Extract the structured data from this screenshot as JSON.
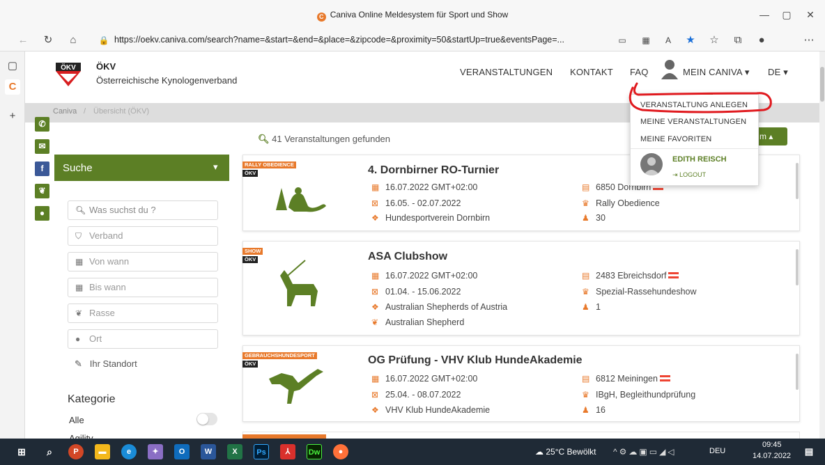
{
  "browser": {
    "window_title": "Caniva Online Meldesystem für Sport und Show",
    "url": "https://oekv.caniva.com/search?name=&start=&end=&place=&zipcode=&proximity=50&startUp=true&eventsPage=..."
  },
  "site": {
    "org_short": "ÖKV",
    "org_name": "Österreichische Kynologenverband",
    "logo_text": "ÖKV",
    "nav": {
      "events": "VERANSTALTUNGEN",
      "contact": "KONTAKT",
      "faq": "FAQ",
      "my_caniva": "MEIN CANIVA",
      "lang": "DE"
    },
    "breadcrumb": {
      "home": "Caniva",
      "sep": "/",
      "current": "Übersicht (ÖKV)"
    }
  },
  "dropdown": {
    "items": [
      "VERANSTALTUNG ANLEGEN",
      "MEINE VERANSTALTUNGEN",
      "MEINE FAVORITEN"
    ],
    "user_name": "EDITH REISCH",
    "logout": "LOGOUT",
    "sort_button_fragment": "m"
  },
  "search": {
    "header": "Suche",
    "fields": {
      "query": "Was suchst du ?",
      "association": "Verband",
      "from": "Von wann",
      "to": "Bis wann",
      "breed": "Rasse",
      "place": "Ort"
    },
    "location": "Ihr Standort",
    "category_title": "Kategorie",
    "categories": [
      "Alle",
      "Agility"
    ]
  },
  "results": {
    "count_text": "41 Veranstaltungen gefunden",
    "events": [
      {
        "tag": "RALLY OBEDIENCE",
        "badge": "ÖKV",
        "title": "4. Dornbirner RO-Turnier",
        "date": "16.07.2022 GMT+02:00",
        "registration": "16.05. - 02.07.2022",
        "club": "Hundesportverein Dornbirn",
        "location": "6850 Dornbirn",
        "discipline": "Rally Obedience",
        "participants": "30"
      },
      {
        "tag": "SHOW",
        "badge": "ÖKV",
        "title": "ASA Clubshow",
        "date": "16.07.2022 GMT+02:00",
        "registration": "01.04. - 15.06.2022",
        "club": "Australian Shepherds of Austria",
        "breed": "Australian Shepherd",
        "location": "2483 Ebreichsdorf",
        "discipline": "Spezial-Rassehundeshow",
        "participants": "1"
      },
      {
        "tag": "GEBRAUCHSHUNDESPORT",
        "badge": "ÖKV",
        "title": "OG Prüfung - VHV Klub HundeAkademie",
        "date": "16.07.2022 GMT+02:00",
        "registration": "25.04. - 08.07.2022",
        "club": "VHV Klub HundeAkademie",
        "location": "6812 Meiningen",
        "discipline": "IBgH, Begleithundprüfung",
        "participants": "16"
      }
    ]
  },
  "taskbar": {
    "weather": "25°C Bewölkt",
    "lang": "DEU",
    "time": "09:45",
    "date": "14.07.2022"
  },
  "colors": {
    "accent_green": "#5c7f25",
    "orange": "#e8792b",
    "annotation_red": "#e0191e"
  }
}
